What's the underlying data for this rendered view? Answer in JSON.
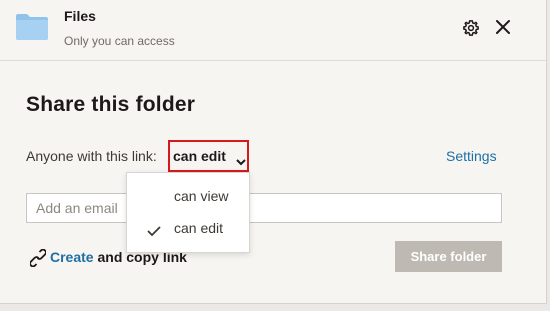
{
  "header": {
    "title": "Files",
    "subtitle": "Only you can access",
    "folder_icon": "folder-icon",
    "settings_icon": "gear-icon",
    "close_icon": "close-icon"
  },
  "share": {
    "title": "Share this folder",
    "link_label": "Anyone with this link:",
    "permission": "can edit",
    "settings_label": "Settings",
    "email_placeholder": "Add an email",
    "create_label": "Create",
    "copy_label": " and copy link",
    "share_button": "Share folder"
  },
  "dropdown": {
    "options": [
      {
        "label": "can view",
        "selected": false
      },
      {
        "label": "can edit",
        "selected": true
      }
    ]
  },
  "colors": {
    "accent_link": "#1d6fa5",
    "highlight_box": "#d7191c",
    "disabled_button": "#bfb9b3",
    "folder": "#8fc3ec"
  }
}
